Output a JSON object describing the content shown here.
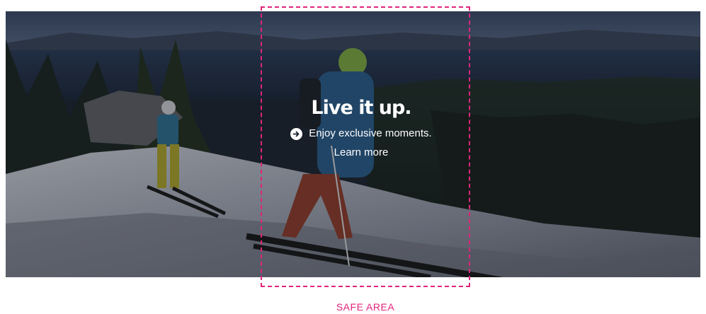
{
  "hero": {
    "headline": "Live it up.",
    "subline": "Enjoy exclusive moments.",
    "cta_label": "Learn more",
    "icon": "arrow-circle-right-icon"
  },
  "safe_area": {
    "label": "SAFE AREA",
    "color": "#e0247c"
  }
}
